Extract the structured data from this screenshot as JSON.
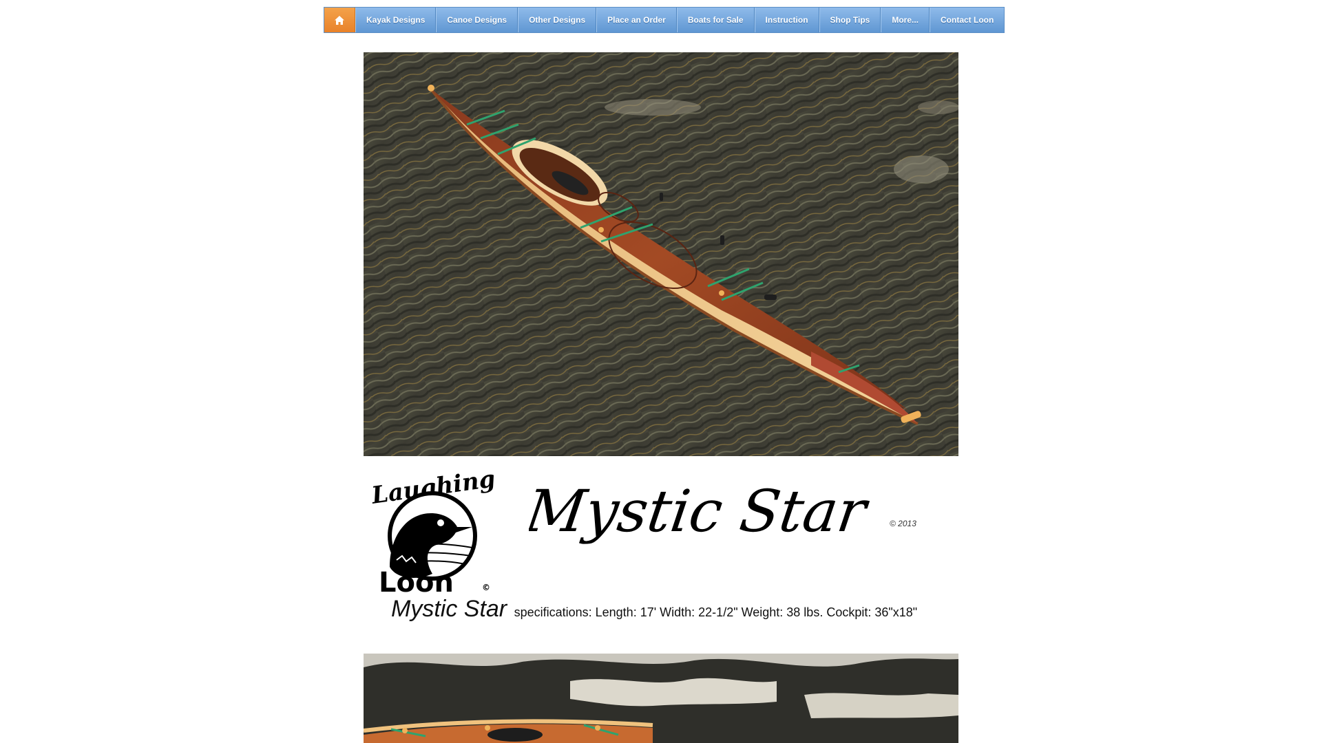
{
  "nav": {
    "home_icon": "home-icon",
    "items": [
      {
        "label": "Kayak Designs"
      },
      {
        "label": "Canoe Designs"
      },
      {
        "label": "Other Designs"
      },
      {
        "label": "Place an Order"
      },
      {
        "label": "Boats for Sale"
      },
      {
        "label": "Instruction"
      },
      {
        "label": "Shop Tips"
      },
      {
        "label": "More..."
      },
      {
        "label": "Contact Loon"
      }
    ],
    "colors": {
      "bar": "#6fa3da",
      "home": "#ef8f35"
    }
  },
  "logo": {
    "top_text": "Laughing",
    "bottom_text": "Loon",
    "mark": "©"
  },
  "title": {
    "script": "Mystic Star",
    "copyright": "© 2013"
  },
  "specs": {
    "model": "Mystic Star",
    "text": "specifications: Length: 17' Width: 22-1/2\" Weight: 38 lbs. Cockpit: 36\"x18\""
  }
}
